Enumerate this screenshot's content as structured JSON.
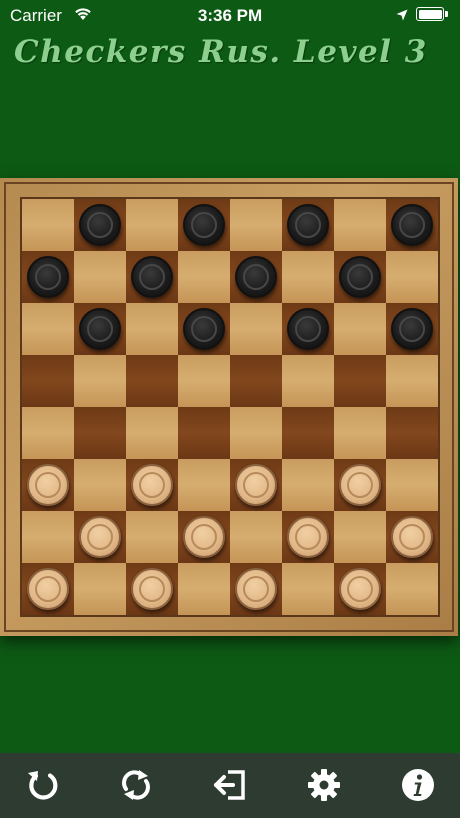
{
  "status_bar": {
    "carrier": "Carrier",
    "time": "3:36 PM"
  },
  "game": {
    "title": "Checkers Rus. Level 3"
  },
  "board": {
    "size": 8,
    "light_square_color": "#d2a86c",
    "dark_square_color": "#7a4019",
    "pieces": [
      {
        "row": 0,
        "col": 1,
        "color": "black"
      },
      {
        "row": 0,
        "col": 3,
        "color": "black"
      },
      {
        "row": 0,
        "col": 5,
        "color": "black"
      },
      {
        "row": 0,
        "col": 7,
        "color": "black"
      },
      {
        "row": 1,
        "col": 0,
        "color": "black"
      },
      {
        "row": 1,
        "col": 2,
        "color": "black"
      },
      {
        "row": 1,
        "col": 4,
        "color": "black"
      },
      {
        "row": 1,
        "col": 6,
        "color": "black"
      },
      {
        "row": 2,
        "col": 1,
        "color": "black"
      },
      {
        "row": 2,
        "col": 3,
        "color": "black"
      },
      {
        "row": 2,
        "col": 5,
        "color": "black"
      },
      {
        "row": 2,
        "col": 7,
        "color": "black"
      },
      {
        "row": 5,
        "col": 0,
        "color": "white"
      },
      {
        "row": 5,
        "col": 2,
        "color": "white"
      },
      {
        "row": 5,
        "col": 4,
        "color": "white"
      },
      {
        "row": 5,
        "col": 6,
        "color": "white"
      },
      {
        "row": 6,
        "col": 1,
        "color": "white"
      },
      {
        "row": 6,
        "col": 3,
        "color": "white"
      },
      {
        "row": 6,
        "col": 5,
        "color": "white"
      },
      {
        "row": 6,
        "col": 7,
        "color": "white"
      },
      {
        "row": 7,
        "col": 0,
        "color": "white"
      },
      {
        "row": 7,
        "col": 2,
        "color": "white"
      },
      {
        "row": 7,
        "col": 4,
        "color": "white"
      },
      {
        "row": 7,
        "col": 6,
        "color": "white"
      }
    ]
  },
  "toolbar": {
    "buttons": [
      {
        "name": "undo-button",
        "icon": "undo-icon"
      },
      {
        "name": "restart-button",
        "icon": "refresh-icon"
      },
      {
        "name": "exit-button",
        "icon": "exit-icon"
      },
      {
        "name": "settings-button",
        "icon": "gear-icon"
      },
      {
        "name": "info-button",
        "icon": "info-icon"
      }
    ]
  },
  "colors": {
    "background": "#0d5a14",
    "title": "#8ccf8e",
    "toolbar": "#2e3b30"
  }
}
